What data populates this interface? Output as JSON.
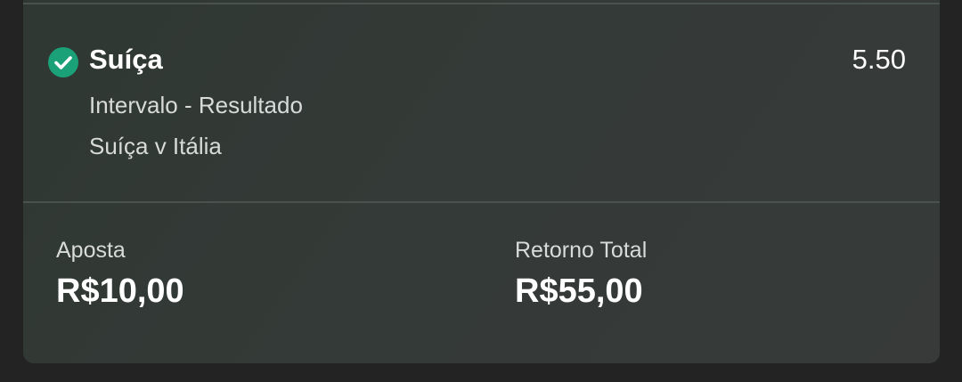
{
  "selection": {
    "status_icon": "check-circle-icon",
    "status_color": "#1aa177",
    "name": "Suíça",
    "odds": "5.50",
    "market": "Intervalo - Resultado",
    "event": "Suíça v Itália"
  },
  "summary": {
    "stake_label": "Aposta",
    "stake_value": "R$10,00",
    "return_label": "Retorno Total",
    "return_value": "R$55,00"
  }
}
